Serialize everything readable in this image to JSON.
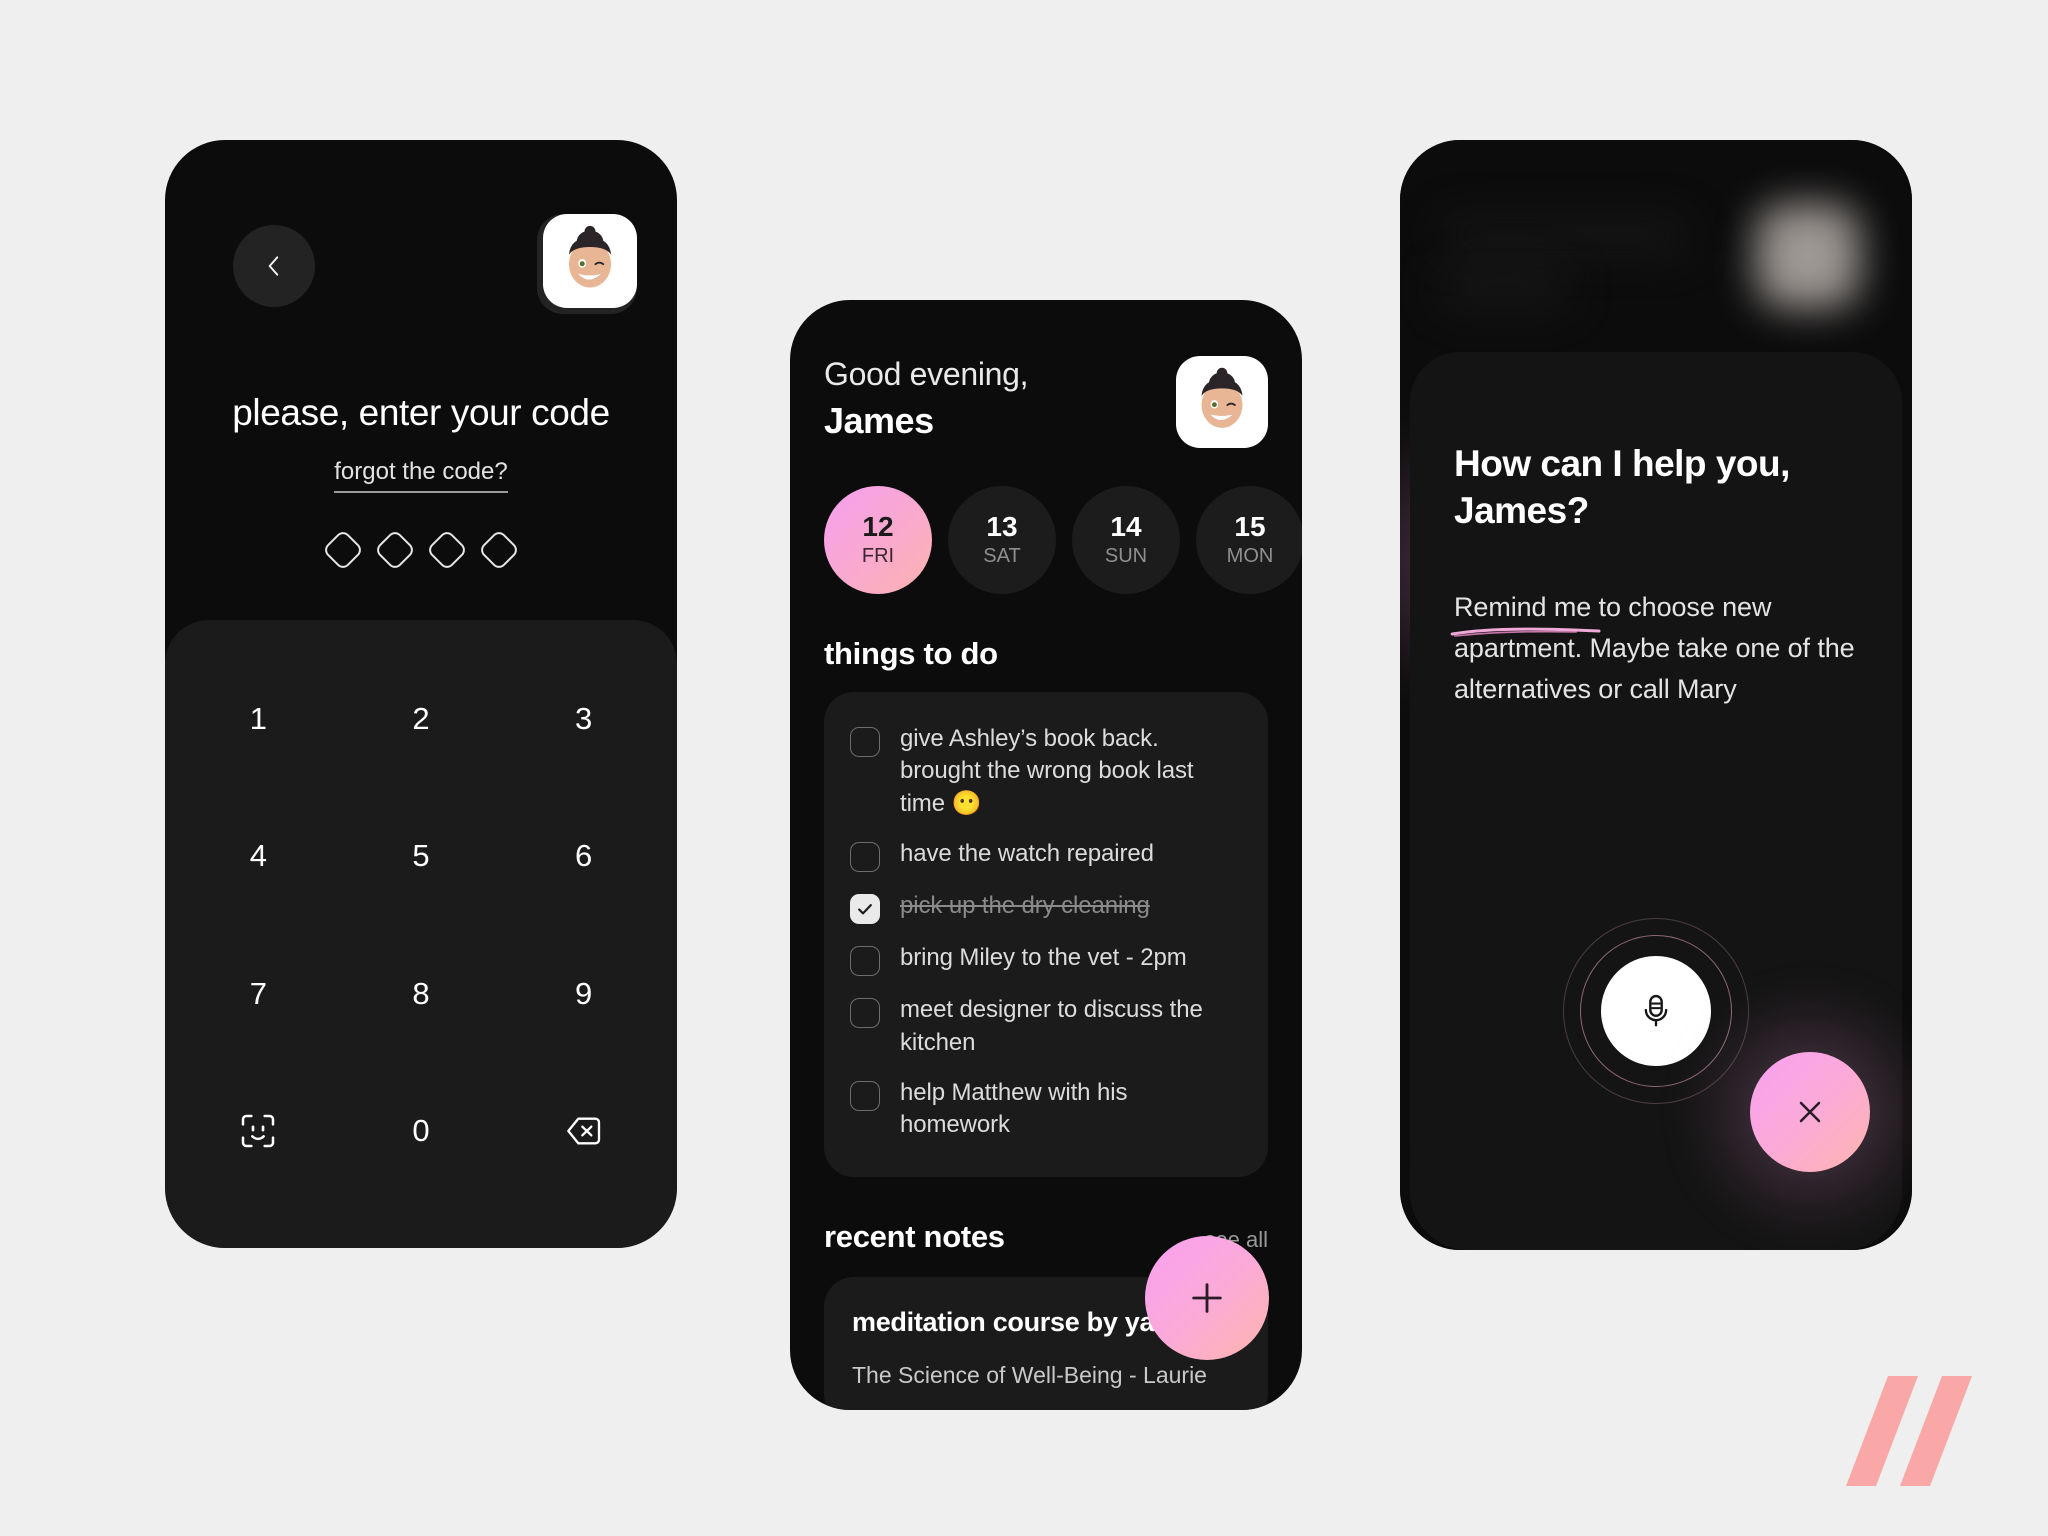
{
  "canvas": {
    "background": "#efefef",
    "accent_pink": "#f9a0f2",
    "accent_peach": "#fdb5ac"
  },
  "brand": {
    "logo_name": "double-slash-logo",
    "logo_color": "#f9a7a7"
  },
  "lock_screen": {
    "back_icon": "chevron-left-icon",
    "avatar_icon": "memoji-avatar",
    "add_account_label": "+",
    "title": "please, enter your code",
    "forgot_label": "forgot the code?",
    "code_length": 4,
    "code_filled": 0,
    "keypad": [
      {
        "label": "1",
        "type": "digit"
      },
      {
        "label": "2",
        "type": "digit"
      },
      {
        "label": "3",
        "type": "digit"
      },
      {
        "label": "4",
        "type": "digit"
      },
      {
        "label": "5",
        "type": "digit"
      },
      {
        "label": "6",
        "type": "digit"
      },
      {
        "label": "7",
        "type": "digit"
      },
      {
        "label": "8",
        "type": "digit"
      },
      {
        "label": "9",
        "type": "digit"
      },
      {
        "label": "face-id",
        "type": "icon",
        "icon": "face-id-icon"
      },
      {
        "label": "0",
        "type": "digit"
      },
      {
        "label": "backspace",
        "type": "icon",
        "icon": "backspace-icon"
      }
    ]
  },
  "home_screen": {
    "greeting": "Good evening,",
    "user_name": "James",
    "avatar_icon": "memoji-avatar",
    "days": [
      {
        "num": "12",
        "day": "FRI",
        "active": true
      },
      {
        "num": "13",
        "day": "SAT",
        "active": false
      },
      {
        "num": "14",
        "day": "SUN",
        "active": false
      },
      {
        "num": "15",
        "day": "MON",
        "active": false
      }
    ],
    "todo_section_title": "things to do",
    "todos": [
      {
        "text": "give Ashley’s book back. brought the wrong book last time 😶",
        "done": false
      },
      {
        "text": "have the watch repaired",
        "done": false
      },
      {
        "text": "pick up the dry cleaning",
        "done": true
      },
      {
        "text": "bring Miley to the vet - 2pm",
        "done": false
      },
      {
        "text": "meet designer to discuss the kitchen",
        "done": false
      },
      {
        "text": "help Matthew with his homework",
        "done": false
      }
    ],
    "notes_section_title": "recent notes",
    "see_all_label": "see all",
    "note": {
      "title": "meditation course by yale",
      "subtitle": "The Science of Well-Being - Laurie"
    },
    "add_button_icon": "plus-icon"
  },
  "assistant_screen": {
    "title": "How can I help you, James?",
    "transcript_highlight": "Remind me",
    "transcript_rest": " to choose new apartment. Maybe take one of the alternatives or call Mary",
    "mic_icon": "microphone-icon",
    "close_icon": "close-icon"
  }
}
